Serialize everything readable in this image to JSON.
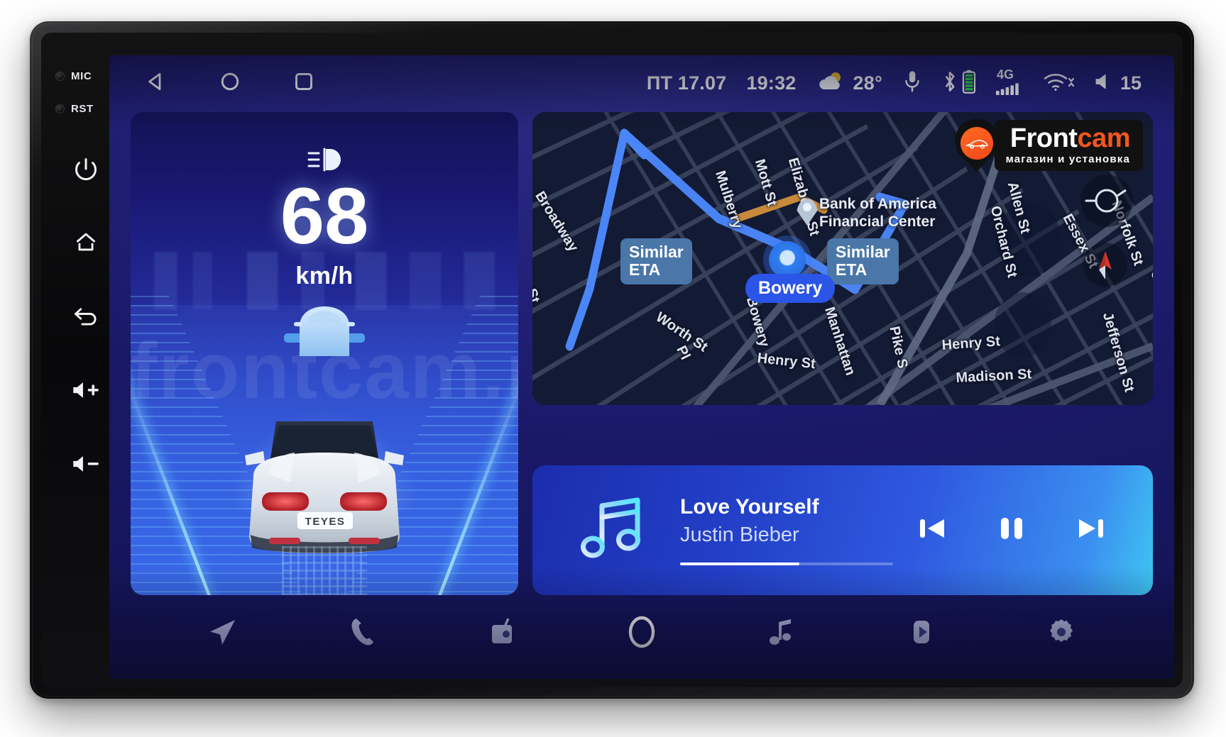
{
  "device": {
    "hw_leds": [
      {
        "label": "MIC",
        "name": "mic-indicator"
      },
      {
        "label": "RST",
        "name": "reset-button"
      }
    ],
    "hw_buttons": [
      {
        "name": "power-button",
        "icon": "power-icon"
      },
      {
        "name": "home-button",
        "icon": "home-icon"
      },
      {
        "name": "back-button",
        "icon": "back-arrow-icon"
      },
      {
        "name": "volume-up-button",
        "icon": "volume-up-icon"
      },
      {
        "name": "volume-down-button",
        "icon": "volume-down-icon"
      }
    ]
  },
  "statusbar": {
    "nav": [
      {
        "name": "android-back-button",
        "icon": "triangle-back-icon"
      },
      {
        "name": "android-home-button",
        "icon": "circle-home-icon"
      },
      {
        "name": "android-recents-button",
        "icon": "square-recents-icon"
      }
    ],
    "date": "ПТ 17.07",
    "time": "19:32",
    "weather_temp": "28°",
    "weather_icon": "partly-cloudy-icon",
    "mic_icon": "microphone-icon",
    "bluetooth_icon": "bluetooth-icon",
    "battery_icon": "battery-full-icon",
    "network_label": "4G",
    "network_icon": "signal-bars-icon",
    "wifi_icon": "wifi-icon",
    "volume_icon": "volume-icon",
    "volume_level": "15"
  },
  "drive_card": {
    "headlight_icon": "low-beam-headlight-icon",
    "speed": "68",
    "unit": "km/h",
    "plate": "TEYES",
    "watermark": "frontcam.ru"
  },
  "map_card": {
    "streets": [
      {
        "text": "Broadway"
      },
      {
        "text": "Mulberry"
      },
      {
        "text": "Mott St"
      },
      {
        "text": "Elizabeth St"
      },
      {
        "text": "Allen St"
      },
      {
        "text": "Orchard St"
      },
      {
        "text": "Essex St"
      },
      {
        "text": "Norfolk St"
      },
      {
        "text": "Gr"
      },
      {
        "text": "Worth St"
      },
      {
        "text": "Bowery"
      },
      {
        "text": "Manhattan"
      },
      {
        "text": "Pike S"
      },
      {
        "text": "Henry St"
      },
      {
        "text": "Henry St"
      },
      {
        "text": "Madison St"
      },
      {
        "text": "Jefferson St"
      },
      {
        "text": "St"
      },
      {
        "text": "Pl"
      }
    ],
    "poi": "Bank of America\nFinancial Center",
    "poi_line1": "Bank of America",
    "poi_line2": "Financial Center",
    "eta_left": "Similar\nETA",
    "eta_left_l1": "Similar",
    "eta_left_l2": "ETA",
    "eta_right_l1": "Similar",
    "eta_right_l2": "ETA",
    "current_street": "Bowery",
    "compass_icon": "compass-icon",
    "north_arrow_icon": "north-arrow-icon",
    "route_color": "#4a86f7",
    "alt_route_color": "#c88a3a"
  },
  "logo": {
    "word_front": "Front",
    "word_cam": "cam",
    "tagline": "магазин и установка",
    "accent": "#f4561d",
    "car_icon": "car-outline-icon"
  },
  "media_card": {
    "note_icon": "music-note-icon",
    "title": "Love Yourself",
    "artist": "Justin Bieber",
    "progress_percent": 56,
    "controls": [
      {
        "name": "previous-track-button",
        "icon": "skip-previous-icon"
      },
      {
        "name": "pause-button",
        "icon": "pause-icon"
      },
      {
        "name": "next-track-button",
        "icon": "skip-next-icon"
      }
    ]
  },
  "dock": {
    "items": [
      {
        "name": "dock-navigation-button",
        "icon": "navigation-arrow-icon"
      },
      {
        "name": "dock-phone-button",
        "icon": "phone-icon"
      },
      {
        "name": "dock-radio-button",
        "icon": "radio-icon"
      },
      {
        "name": "dock-home-button",
        "icon": "home-circle-icon"
      },
      {
        "name": "dock-music-button",
        "icon": "music-note-icon"
      },
      {
        "name": "dock-video-button",
        "icon": "video-play-icon"
      },
      {
        "name": "dock-settings-button",
        "icon": "gear-icon"
      }
    ]
  }
}
